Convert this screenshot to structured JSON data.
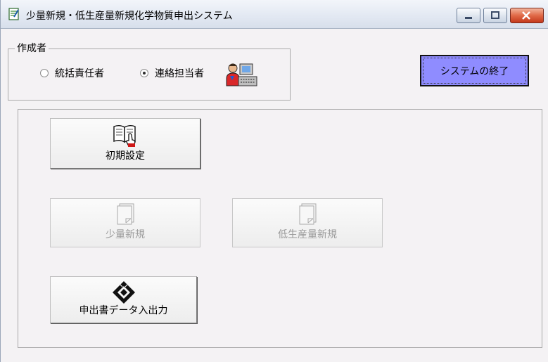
{
  "window": {
    "title": "少量新規・低生産量新規化学物質申出システム",
    "icons": {
      "app": "app-document-icon",
      "minimize": "minimize-icon",
      "maximize": "maximize-icon",
      "close": "close-icon"
    }
  },
  "creator_group": {
    "label": "作成者",
    "options": [
      {
        "label": "統括責任者",
        "selected": false
      },
      {
        "label": "連絡担当者",
        "selected": true
      }
    ],
    "icon": "person-at-computer-icon"
  },
  "exit_button": {
    "label": "システムの終了"
  },
  "main_buttons": {
    "initial_settings": {
      "label": "初期設定",
      "icon": "book-with-hand-icon",
      "enabled": true
    },
    "small_quantity_new": {
      "label": "少量新規",
      "icon": "blank-document-icon",
      "enabled": false
    },
    "low_production_new": {
      "label": "低生産量新規",
      "icon": "blank-document-icon",
      "enabled": false
    },
    "application_data_io": {
      "label": "申出書データ入出力",
      "icon": "floppy-disk-icon",
      "enabled": true
    }
  },
  "colors": {
    "exit_button_bg": "#8f8cff",
    "window_bg": "#f4f2f4",
    "disabled_text": "#9a9a9a"
  }
}
